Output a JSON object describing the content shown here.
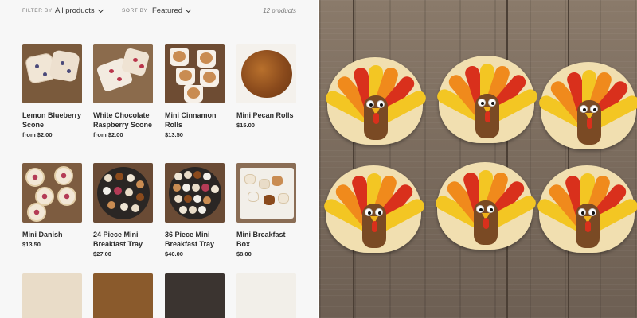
{
  "filters": {
    "filter_label": "FILTER BY",
    "filter_value": "All products",
    "sort_label": "SORT BY",
    "sort_value": "Featured",
    "count": "12 products"
  },
  "products": [
    {
      "title": "Lemon Blueberry Scone",
      "price": "from $2.00"
    },
    {
      "title": "White Chocolate Raspberry Scone",
      "price": "from $2.00"
    },
    {
      "title": "Mini Cinnamon Rolls",
      "price": "$13.50"
    },
    {
      "title": "Mini Pecan Rolls",
      "price": "$15.00"
    },
    {
      "title": "Mini Danish",
      "price": "$13.50"
    },
    {
      "title": "24 Piece Mini Breakfast Tray",
      "price": "$27.00"
    },
    {
      "title": "36 Piece Mini Breakfast Tray",
      "price": "$40.00"
    },
    {
      "title": "Mini Breakfast Box",
      "price": "$8.00"
    }
  ],
  "colors": {
    "page_bg": "#f7f7f7",
    "text": "#2b2b2b",
    "muted": "#777777",
    "turkey_yellow": "#f3c623",
    "turkey_orange": "#f08a1c",
    "turkey_red": "#d9301c",
    "turkey_body": "#7a4a24",
    "cookie_base": "#f1dfb0"
  },
  "icons": {
    "filter_dropdown": "chevron-down-icon",
    "sort_dropdown": "chevron-down-icon"
  }
}
